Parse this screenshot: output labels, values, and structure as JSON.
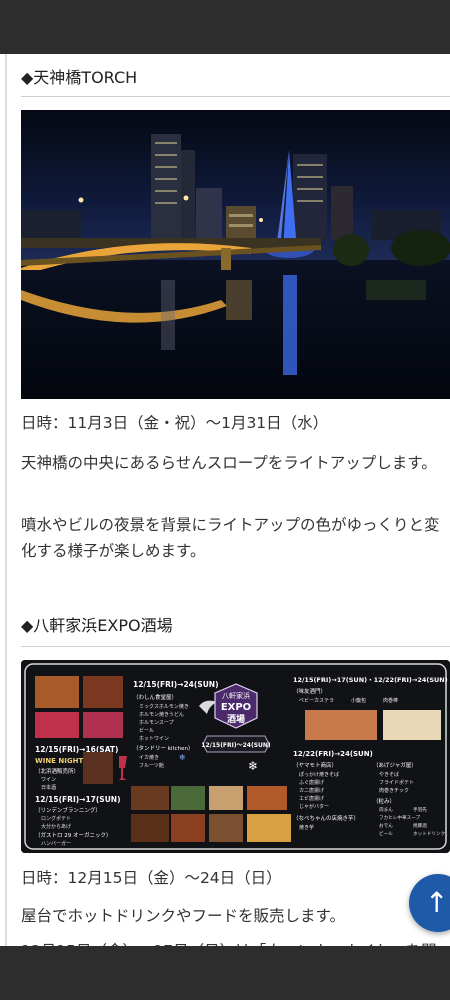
{
  "section1": {
    "heading": "◆天神橋TORCH",
    "date": "日時：11月3日（金・祝）〜1月31日（水）",
    "desc1": "天神橋の中央にあるらせんスロープをライトアップします。",
    "desc2": "噴水やビルの夜景を背景にライトアップの色がゆっくりと変化する様子が楽しめます。"
  },
  "section2": {
    "heading": "◆八軒家浜EXPO酒場",
    "date": "日時：12月15日（金）〜24日（日）",
    "desc1": "屋台でホットドリンクやフードを販売します。",
    "desc2_partial": "12月15日（金）〜17日（日）は「ウィンナーナイト」を開"
  },
  "poster": {
    "logo_top": "八軒家浜",
    "logo_main": "EXPO",
    "logo_bottom": "酒場",
    "ribbon": "12/15(FRI)〜24(SUN)",
    "date_a": "12/15(FRI)→24(SUN)",
    "shop_a": "（わしん食堂屋）",
    "items_a": [
      "ミックスホルモン焼き",
      "ホルモン焼きうどん",
      "ホルモンスープ",
      "ビール",
      "ホットワイン"
    ],
    "shop_a2": "（タンドリー kitchen）",
    "items_a2": [
      "イカ焼き",
      "フルーツ飴"
    ],
    "date_b": "12/15(FRI)→16(SAT)",
    "wine_night": "WINE NIGHT",
    "shop_b": "（北浜酒販売所）",
    "items_b": [
      "ワイン",
      "日本酒"
    ],
    "date_c": "12/15(FRI)→17(SUN)",
    "shop_c": "（リンデンブランニング）",
    "items_c": [
      "ロングポテト",
      "大分からあげ"
    ],
    "shop_c2": "（ガストロ 29 オーガニック）",
    "items_c2": [
      "ハンバーガー"
    ],
    "date_d": "12/15(FRI)→17(SUN)・12/22(FRI)→24(SUN)",
    "shop_d": "（味友酒門）",
    "items_d": [
      "ベビーカステラ",
      "小籠包",
      "肉巻棒"
    ],
    "date_e": "12/22(FRI)→24(SUN)",
    "shop_e": "（ヤマモト商店）",
    "items_e": [
      "ぽっかけ焼きそば",
      "ふぐ唐揚げ",
      "カニ唐揚げ",
      "エビ唐揚げ",
      "じゃがバター"
    ],
    "shop_e2": "（なべちゃんの店焼き芋）",
    "items_e2": [
      "焼き芋"
    ],
    "shop_f": "（あげジャガ屋）",
    "items_f": [
      "やきそば",
      "フライドポテト",
      "肉巻きチック"
    ],
    "shop_f2": "（粒み）",
    "items_f2": [
      "肉まん",
      "手羽先",
      "フカヒレ中華スープ",
      "おでん",
      "焼豚酒",
      "ビール",
      "ホットドリンク"
    ]
  },
  "scroll_button": {
    "icon": "arrow-up-icon",
    "glyph": "↑"
  },
  "colors": {
    "topbar": "#2d2d2d",
    "button": "#1e5aa8",
    "rule": "#cfcfcf"
  }
}
